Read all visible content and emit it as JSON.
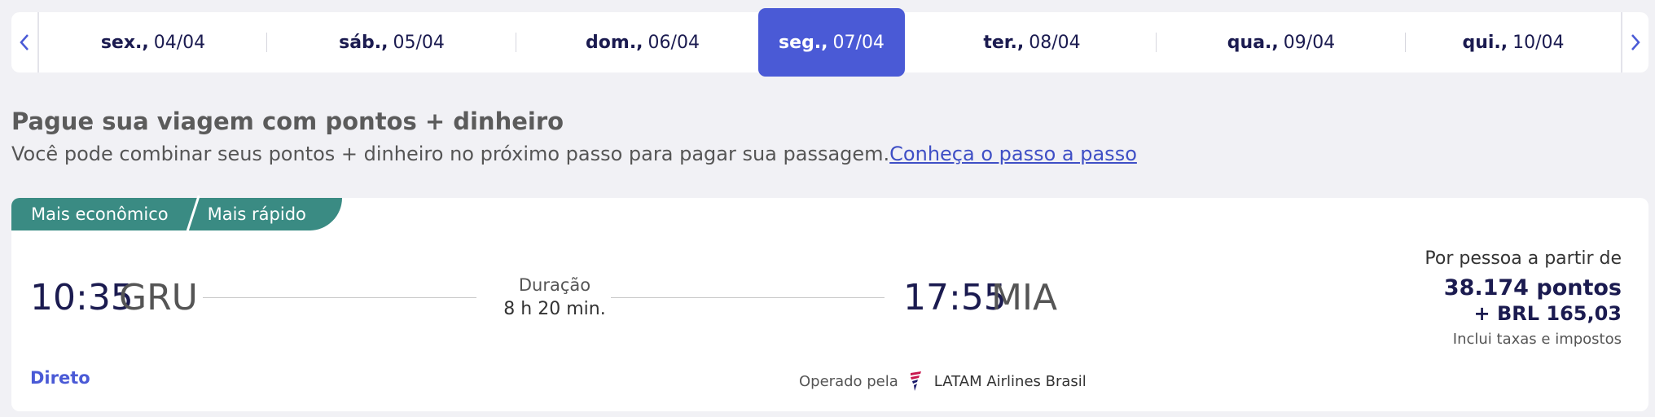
{
  "dates": {
    "days": [
      {
        "weekday": "sex.,",
        "date": "04/04"
      },
      {
        "weekday": "sáb.,",
        "date": "05/04"
      },
      {
        "weekday": "dom.,",
        "date": "06/04"
      },
      {
        "weekday": "seg.,",
        "date": "07/04"
      },
      {
        "weekday": "ter.,",
        "date": "08/04"
      },
      {
        "weekday": "qua.,",
        "date": "09/04"
      },
      {
        "weekday": "qui.,",
        "date": "10/04"
      }
    ],
    "selected_index": 3,
    "prev_icon": "chevron-left-icon",
    "next_icon": "chevron-right-icon"
  },
  "heading": {
    "title": "Pague sua viagem com pontos + dinheiro",
    "subtitle": "Você pode combinar seus pontos + dinheiro no próximo passo para pagar sua passagem.",
    "link": "Conheça o passo a passo"
  },
  "flight": {
    "badges": [
      "Mais econômico",
      "Mais rápido"
    ],
    "departure_time": "10:35",
    "departure_code": "GRU",
    "duration_label": "Duração",
    "duration_value": "8 h 20 min.",
    "arrival_time": "17:55",
    "arrival_code": "MIA",
    "stops": "Direto",
    "operated_by": "Operado pela",
    "airline": "LATAM Airlines Brasil",
    "price_label": "Por pessoa a partir de",
    "price_points": "38.174 pontos",
    "price_money": "+ BRL 165,03",
    "price_note": "Inclui taxas e impostos"
  },
  "colors": {
    "accent": "#4a5ad6",
    "badge": "#3a8b83",
    "text_dark": "#1b1b50"
  }
}
